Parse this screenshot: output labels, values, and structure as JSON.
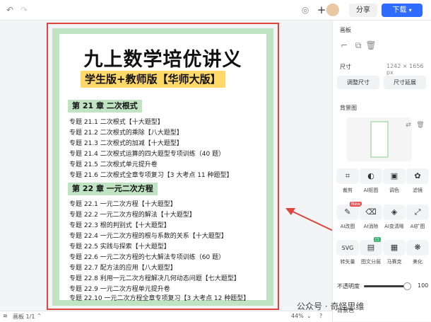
{
  "topbar": {
    "share_label": "分享",
    "download_label": "下载",
    "download_caret": "▾"
  },
  "poster": {
    "title": "九上数学培优讲义",
    "subtitle": "学生版+教师版【华师大版】",
    "chapter21": {
      "heading": "第 21 章 二次根式",
      "items": [
        "专题 21.1 二次根式【十大题型】",
        "专题 21.2 二次根式的乘除【八大题型】",
        "专题 21.3 二次根式的加减【十大题型】",
        "专题 21.4 二次根式运算的四大题型专项训练（40 题）",
        "专题 21.5 二次根式单元提升卷",
        "专题 21.6 二次根式全章专项复习【3 大考点 11 种题型】"
      ]
    },
    "chapter22": {
      "heading": "第 22 章 一元二次方程",
      "items": [
        "专题 22.1 一元二次方程【十大题型】",
        "专题 22.2 一元二次方程的解法【十大题型】",
        "专题 22.3 根的判别式【十大题型】",
        "专题 22.4 一元二次方程的根与系数的关系【十大题型】",
        "专题 22.5 实践与探索【十大题型】",
        "专题 22.6 一元二次方程的七大解法专项训练（60 题）",
        "专题 22.7 配方法的应用【八大题型】",
        "专题 22.8 利用一元二次方程解决几何动态问题【七大题型】",
        "专题 22.9 一元二次方程单元提升卷",
        "专题 22.10 一元二次方程全章专项复习【3 大考点 12 种题型】"
      ]
    }
  },
  "bottombar": {
    "page_label": "画板 1/1",
    "zoom": "44%"
  },
  "panel": {
    "section_canvas": "画板",
    "size_label": "尺寸",
    "size_value": "1242 × 1656 px",
    "adjust_size": "调整尺寸",
    "extend_size": "尺寸延展",
    "background_label": "背景图",
    "tools": [
      {
        "label": "裁剪",
        "icon": "crop-icon"
      },
      {
        "label": "AI抠图",
        "icon": "cutout-icon"
      },
      {
        "label": "调色",
        "icon": "color-adjust-icon"
      },
      {
        "label": "滤镜",
        "icon": "filter-icon"
      },
      {
        "label": "AI改图",
        "icon": "ai-edit-icon"
      },
      {
        "label": "AI消除",
        "icon": "ai-erase-icon"
      },
      {
        "label": "AI变清晰",
        "icon": "ai-sharpen-icon"
      },
      {
        "label": "AI扩图",
        "icon": "ai-expand-icon"
      },
      {
        "label": "转矢量",
        "icon": "vector-icon"
      },
      {
        "label": "图文分层",
        "icon": "layer-split-icon"
      },
      {
        "label": "马赛克",
        "icon": "mosaic-icon"
      },
      {
        "label": "美化",
        "icon": "beautify-icon"
      }
    ],
    "new_badge": "New",
    "opacity_label": "不透明度",
    "opacity_value": "100",
    "bg_color_label": "背景色"
  },
  "watermark": "公众号 · 奇怪思维"
}
